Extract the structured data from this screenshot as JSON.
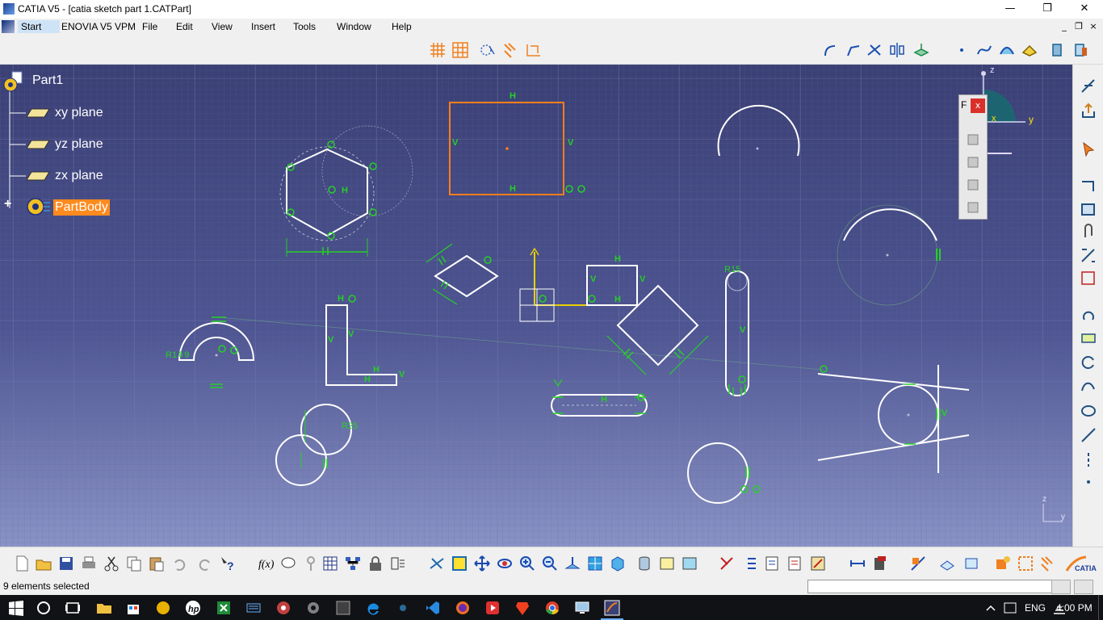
{
  "window": {
    "title": "CATIA V5 - [catia sketch part 1.CATPart]",
    "minimize_glyph": "—",
    "maximize_glyph": "❐",
    "close_glyph": "✕",
    "mdi_minimize": "_",
    "mdi_restore": "❐",
    "mdi_close": "×"
  },
  "menubar": {
    "items": [
      "Start",
      "ENOVIA V5 VPM",
      "File",
      "Edit",
      "View",
      "Insert",
      "Tools",
      "Window",
      "Help"
    ],
    "active": "Start"
  },
  "tree": {
    "root": "Part1",
    "items": [
      "xy plane",
      "yz plane",
      "zx plane",
      "PartBody"
    ],
    "selected": "PartBody",
    "expand_glyph": "+"
  },
  "float_palette": {
    "letter": "F",
    "close_glyph": "x"
  },
  "compass": {
    "z_label": "z",
    "y_label": "y",
    "x_label": "x"
  },
  "axis_indicator": {
    "z_label": "z",
    "y_label": "y"
  },
  "sketch_labels": {
    "r15_slot": "R15",
    "r_arc": "R1⚱9",
    "r_circle": "R25",
    "h": "H",
    "v": "V"
  },
  "status": {
    "message": "9 elements selected",
    "command_input": ""
  },
  "taskbar": {
    "language": "ENG",
    "time": "4:00 PM"
  },
  "colors": {
    "sketch_line": "#ffffff",
    "constraint": "#25d025",
    "selected": "#ff7e1a",
    "axis_h": "#e6d100",
    "canvas_top": "#3a3f74",
    "canvas_bottom": "#8a93c6",
    "tree_selected_bg": "#ff8a1e"
  }
}
